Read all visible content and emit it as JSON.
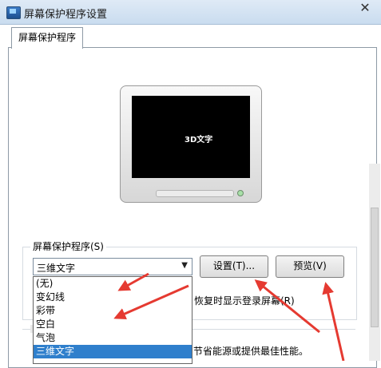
{
  "window": {
    "title": "屏幕保护程序设置",
    "close_glyph": "✕"
  },
  "tab": {
    "label": "屏幕保护程序"
  },
  "preview": {
    "screen_text": "3D文字"
  },
  "screensaver_group": {
    "label": "屏幕保护程序(S)",
    "selected": "三维文字",
    "options": [
      "(无)",
      "变幻线",
      "彩带",
      "空白",
      "气泡",
      "三维文字"
    ],
    "settings_button": "设置(T)...",
    "preview_button": "预览(V)",
    "partial_text_resume": "恢复时显示登录屏幕(R)"
  },
  "power_group": {
    "partial_text": "节省能源或提供最佳性能。"
  },
  "colors": {
    "annotation_red": "#e53a31",
    "selection_blue": "#2f7fcc"
  }
}
